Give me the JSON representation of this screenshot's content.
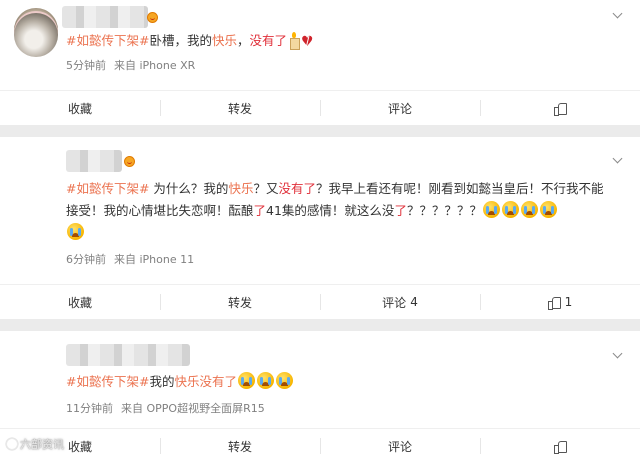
{
  "posts": [
    {
      "hashtag": "#如懿传下架#",
      "text_parts": [
        "卧槽，我的",
        "快乐",
        "，",
        "没有了"
      ],
      "time": "5分钟前",
      "source": "来自 iPhone XR",
      "actions": {
        "collect": "收藏",
        "repost": "转发",
        "comment": "评论",
        "comment_count": "",
        "like_count": ""
      }
    },
    {
      "hashtag": "#如懿传下架#",
      "text_parts": [
        " 为什么？我的",
        "快乐",
        "？又",
        "没有了",
        "？我早上看还有呢！刚看到如懿当皇后！不行我不能接受！我的心情堪比失恋啊！酝酿",
        "了",
        "41集的感情！就这么没",
        "了",
        "？？？？？？"
      ],
      "time": "6分钟前",
      "source": "来自 iPhone 11",
      "actions": {
        "collect": "收藏",
        "repost": "转发",
        "comment": "评论",
        "comment_count": "4",
        "like_count": "1"
      }
    },
    {
      "hashtag": "#如懿传下架#",
      "text_parts": [
        "我的",
        "快乐没有了"
      ],
      "time": "11分钟前",
      "source": "来自 OPPO超视野全面屏R15",
      "actions": {
        "collect": "收藏",
        "repost": "转发",
        "comment": "评论",
        "comment_count": "",
        "like_count": ""
      }
    }
  ],
  "watermark": "六部资讯",
  "colors": {
    "tag": "#eb7350",
    "red_text": "#e0303a",
    "background": "#ebebeb"
  },
  "icons": [
    "chevron-down-icon",
    "like-icon",
    "crying-emoji-icon",
    "candle-icon",
    "broken-heart-icon",
    "vip-badge-icon"
  ]
}
